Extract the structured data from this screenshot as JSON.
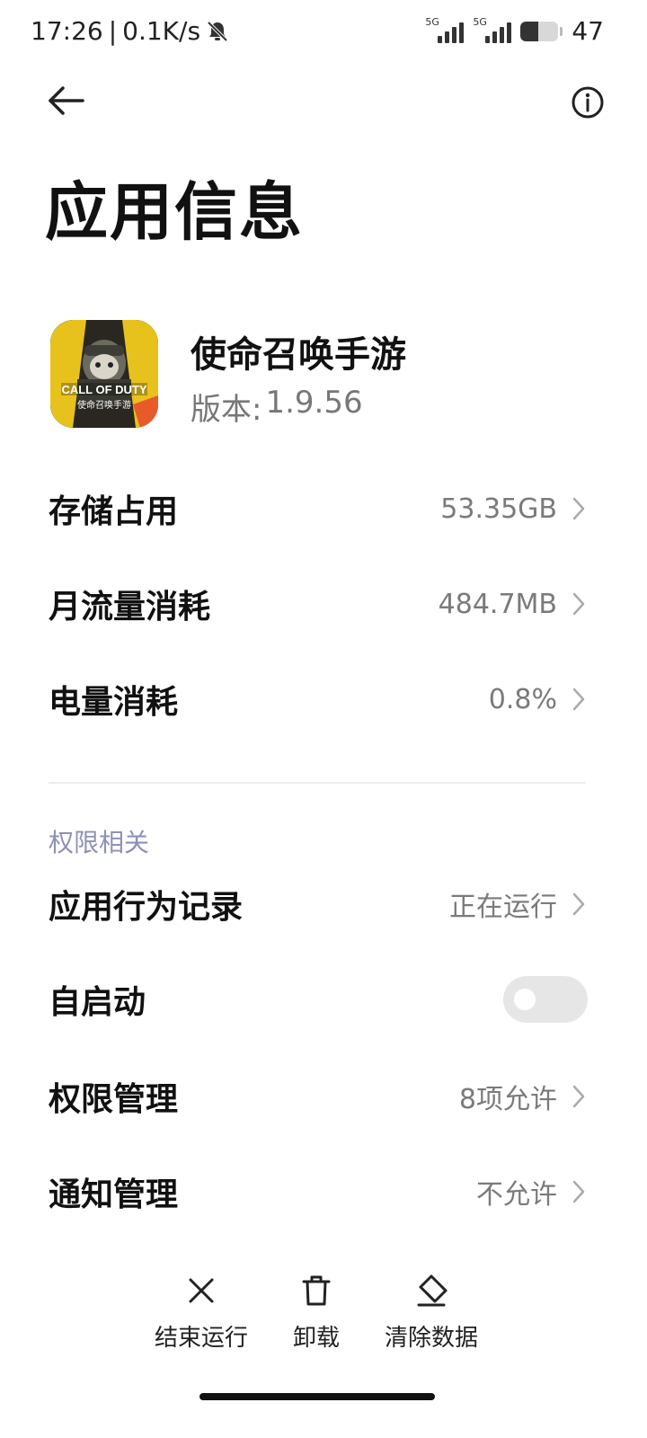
{
  "status_bar": {
    "time": "17:26",
    "separator": "|",
    "net_speed": "0.1K/s",
    "signal1": "5G",
    "signal2": "5G",
    "battery": "47"
  },
  "header": {
    "title": "应用信息"
  },
  "app": {
    "name": "使命召唤手游",
    "version_label": "版本:",
    "version": "1.9.56",
    "icon_text_main": "CALL OF DUTY",
    "icon_text_sub": "使命召唤手游"
  },
  "usage_rows": [
    {
      "label": "存储占用",
      "value": "53.35GB"
    },
    {
      "label": "月流量消耗",
      "value": "484.7MB"
    },
    {
      "label": "电量消耗",
      "value": "0.8%"
    }
  ],
  "permissions": {
    "section_title": "权限相关",
    "rows": [
      {
        "label": "应用行为记录",
        "value": "正在运行"
      },
      {
        "label": "自启动",
        "toggle": false
      },
      {
        "label": "权限管理",
        "value": "8项允许"
      },
      {
        "label": "通知管理",
        "value": "不允许"
      }
    ]
  },
  "actions": [
    {
      "label": "结束运行",
      "icon": "close-icon"
    },
    {
      "label": "卸载",
      "icon": "trash-icon"
    },
    {
      "label": "清除数据",
      "icon": "eraser-icon"
    }
  ],
  "colors": {
    "section_header": "#8b92b5",
    "value_text": "#7a7a7a",
    "toggle_off": "#e6e6e6"
  }
}
